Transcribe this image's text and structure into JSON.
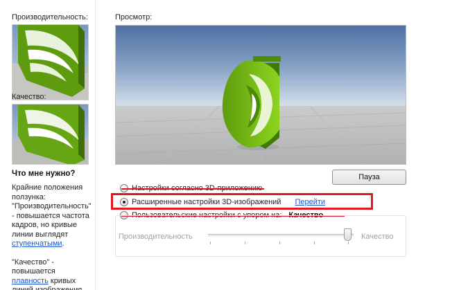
{
  "left_panel": {
    "performance_label": "Производительность:",
    "quality_label": "Качество:",
    "help_title": "Что мне нужно?",
    "help_text_1": "Крайние положения ползунка: \"Производительность\" - повышается частота кадров, но кривые линии выглядят",
    "help_link_1": "ступенчатыми",
    "help_text_1_end": ".",
    "help_text_2": "\"Качество\" - повышается",
    "help_link_2": "плавность",
    "help_text_2_end": "кривых линий изображения."
  },
  "preview": {
    "label": "Просмотр:",
    "pause_button": "Пауза"
  },
  "options": [
    {
      "label": "Настройки согласно 3D-приложению",
      "selected": false,
      "crossed_out": true
    },
    {
      "label": "Расширенные настройки 3D-изображений",
      "selected": true,
      "link": "Перейти",
      "highlighted": true
    },
    {
      "label": "Пользовательские настройки с упором на:",
      "selected": false,
      "crossed_out": true,
      "value": "Качество"
    }
  ],
  "slider": {
    "left_label": "Производительность",
    "right_label": "Качество",
    "position_fraction": 1.0,
    "enabled": false
  },
  "colors": {
    "highlight": "#e3161f",
    "link": "#1a56c9",
    "nvidia_green": "#76b900"
  }
}
